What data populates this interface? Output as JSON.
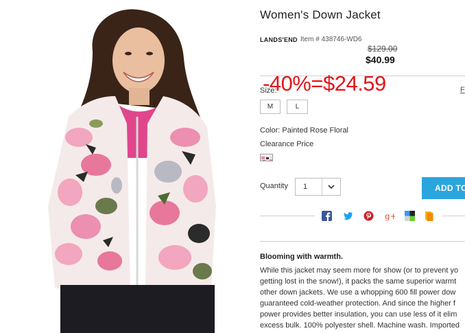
{
  "product": {
    "title": "Women's Down Jacket",
    "brand": "LANDS'END",
    "item_number": "Item # 438746-WD6",
    "original_price": "$129.00",
    "sale_price": "$40.99",
    "discount_overlay": "-40%=$24.59"
  },
  "options": {
    "size_label": "Size:",
    "size_guide_label": "F",
    "sizes": [
      "M",
      "L"
    ],
    "color_label": "Color: Painted Rose Floral",
    "price_type_label": "Clearance Price"
  },
  "purchase": {
    "quantity_label": "Quantity",
    "quantity_value": "1",
    "add_button_label": "ADD TO"
  },
  "share": {
    "icons": [
      "facebook-icon",
      "twitter-icon",
      "pinterest-icon",
      "google-plus-icon",
      "delicious-icon",
      "share-bookmark-icon"
    ]
  },
  "description": {
    "heading": "Blooming with warmth.",
    "lines": [
      "While this jacket may seem more for show (or to prevent yo",
      "getting lost in the snow!), it packs the same superior warmt",
      "other down jackets. We use a whopping 600 fill power dow",
      "guaranteed cold-weather protection. And since the higher f",
      "power provides better insulation, you can use less of it elim",
      "excess bulk. 100% polyester shell. Machine wash. Imported"
    ]
  },
  "colors": {
    "accent_button": "#2aa5dd",
    "discount_red": "#e3151a",
    "facebook": "#3b5998",
    "twitter": "#1da1f2",
    "pinterest": "#cb2027",
    "google_plus": "#dd4b39"
  }
}
